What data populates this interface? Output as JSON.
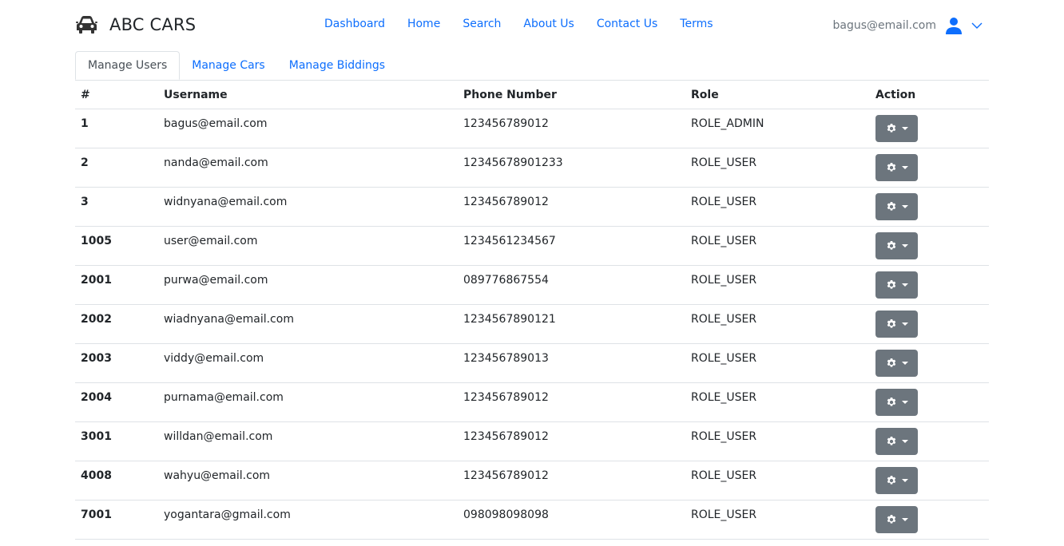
{
  "brand": {
    "name": "ABC CARS",
    "icon": "car-icon"
  },
  "nav": [
    {
      "label": "Dashboard"
    },
    {
      "label": "Home"
    },
    {
      "label": "Search"
    },
    {
      "label": "About Us"
    },
    {
      "label": "Contact Us"
    },
    {
      "label": "Terms"
    }
  ],
  "user": {
    "email": "bagus@email.com",
    "icon": "user-icon"
  },
  "tabs": [
    {
      "label": "Manage Users",
      "active": true
    },
    {
      "label": "Manage Cars",
      "active": false
    },
    {
      "label": "Manage Biddings",
      "active": false
    }
  ],
  "table": {
    "headers": [
      "#",
      "Username",
      "Phone Number",
      "Role",
      "Action"
    ],
    "rows": [
      {
        "id": "1",
        "username": "bagus@email.com",
        "phone": "123456789012",
        "role": "ROLE_ADMIN"
      },
      {
        "id": "2",
        "username": "nanda@email.com",
        "phone": "12345678901233",
        "role": "ROLE_USER"
      },
      {
        "id": "3",
        "username": "widnyana@email.com",
        "phone": "123456789012",
        "role": "ROLE_USER"
      },
      {
        "id": "1005",
        "username": "user@email.com",
        "phone": "1234561234567",
        "role": "ROLE_USER"
      },
      {
        "id": "2001",
        "username": "purwa@email.com",
        "phone": "089776867554",
        "role": "ROLE_USER"
      },
      {
        "id": "2002",
        "username": "wiadnyana@email.com",
        "phone": "1234567890121",
        "role": "ROLE_USER"
      },
      {
        "id": "2003",
        "username": "viddy@email.com",
        "phone": "123456789013",
        "role": "ROLE_USER"
      },
      {
        "id": "2004",
        "username": "purnama@email.com",
        "phone": "123456789012",
        "role": "ROLE_USER"
      },
      {
        "id": "3001",
        "username": "willdan@email.com",
        "phone": "123456789012",
        "role": "ROLE_USER"
      },
      {
        "id": "4008",
        "username": "wahyu@email.com",
        "phone": "123456789012",
        "role": "ROLE_USER"
      },
      {
        "id": "7001",
        "username": "yogantara@gmail.com",
        "phone": "098098098098",
        "role": "ROLE_USER"
      }
    ]
  },
  "colors": {
    "link": "#0d6efd",
    "button": "#6c757d",
    "border": "#dee2e6"
  }
}
